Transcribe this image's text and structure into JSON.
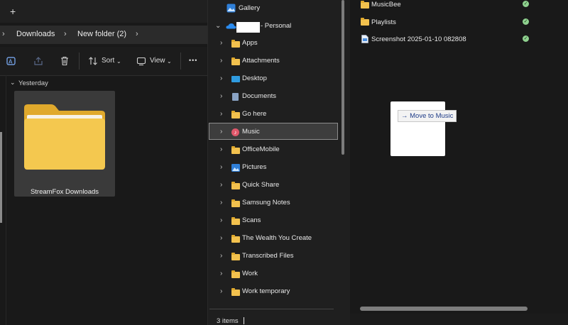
{
  "left_window": {
    "new_tab_glyph": "+",
    "breadcrumb": [
      "Downloads",
      "New folder (2)"
    ],
    "toolbar": {
      "sort_label": "Sort",
      "view_label": "View",
      "more_glyph": "•••"
    },
    "group_header": "Yesterday",
    "items": [
      {
        "name": "StreamFox Downloads",
        "icon": "folder-icon"
      }
    ]
  },
  "nav_pane": {
    "top_items": [
      {
        "label": "Gallery",
        "icon": "gallery-icon"
      },
      {
        "label": "- Personal",
        "icon": "onedrive-cloud-icon"
      }
    ],
    "items": [
      {
        "label": "Apps",
        "icon": "folder"
      },
      {
        "label": "Attachments",
        "icon": "folder"
      },
      {
        "label": "Desktop",
        "icon": "desktop"
      },
      {
        "label": "Documents",
        "icon": "documents"
      },
      {
        "label": "Go here",
        "icon": "folder"
      },
      {
        "label": "Music",
        "icon": "music",
        "selected": true
      },
      {
        "label": "OfficeMobile",
        "icon": "folder"
      },
      {
        "label": "Pictures",
        "icon": "pictures"
      },
      {
        "label": "Quick Share",
        "icon": "folder"
      },
      {
        "label": "Samsung Notes",
        "icon": "folder"
      },
      {
        "label": "Scans",
        "icon": "folder"
      },
      {
        "label": "The Wealth You Create",
        "icon": "folder"
      },
      {
        "label": "Transcribed Files",
        "icon": "folder"
      },
      {
        "label": "Work",
        "icon": "folder"
      },
      {
        "label": "Work temporary",
        "icon": "folder"
      }
    ]
  },
  "status_bar": {
    "items_count": "3 items"
  },
  "right_window": {
    "items": [
      {
        "name": "MusicBee",
        "icon": "folder",
        "sync": "synced"
      },
      {
        "name": "Playlists",
        "icon": "folder",
        "sync": "synced"
      },
      {
        "name": "Screenshot 2025-01-10 082808",
        "icon": "image-file",
        "sync": "synced"
      }
    ]
  },
  "drag_tooltip": {
    "arrow": "→",
    "text": "Move to Music"
  },
  "colors": {
    "selection_bg": "#3d3d3d",
    "folder_yellow": "#f2c14e",
    "sync_green": "#8fd18f",
    "tooltip_text": "#1f3c88"
  }
}
